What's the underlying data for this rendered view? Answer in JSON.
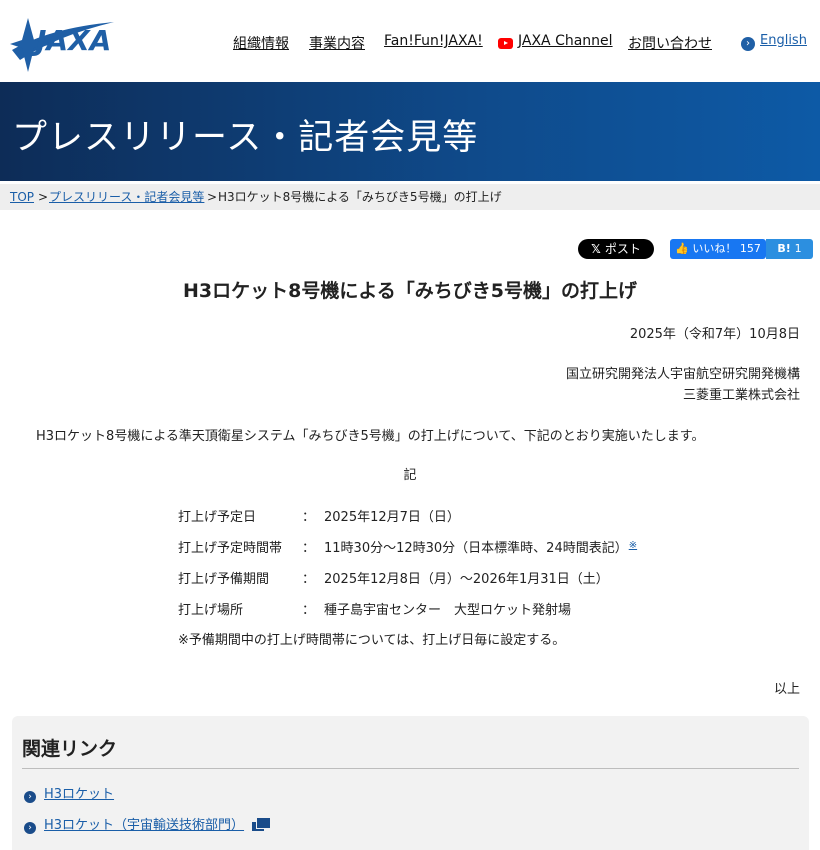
{
  "header": {
    "logo_text": "JAXA",
    "nav": [
      {
        "label": "組織情報"
      },
      {
        "label": "事業内容"
      },
      {
        "label": "Fan!Fun!JAXA!"
      },
      {
        "label": "JAXA Channel"
      },
      {
        "label": "お問い合わせ"
      }
    ],
    "english_label": "English"
  },
  "banner": {
    "title": "プレスリリース・記者会見等"
  },
  "breadcrumb": {
    "sep": ">",
    "items": [
      {
        "label": "TOP"
      },
      {
        "label": "プレスリリース・記者会見等"
      },
      {
        "label": "H3ロケット8号機による「みちびき5号機」の打上げ"
      }
    ]
  },
  "social": {
    "x_label": "ポスト",
    "fb_label": "いいね！",
    "fb_count": "157",
    "hatena_label": "B!",
    "hatena_count": "1"
  },
  "article": {
    "title": "H3ロケット8号機による「みちびき5号機」の打上げ",
    "date": "2025年（令和7年）10月8日",
    "org1": "国立研究開発法人宇宙航空研究開発機構",
    "org2": "三菱重工業株式会社",
    "intro": "H3ロケット8号機による準天頂衛星システム「みちびき5号機」の打上げについて、下記のとおり実施いたします。",
    "ki": "記",
    "colon": "：",
    "rows": [
      {
        "label": "打上げ予定日",
        "value": "2025年12月7日（日）"
      },
      {
        "label": "打上げ予定時間帯",
        "value": "11時30分～12時30分（日本標準時、24時間表記）",
        "note_mark": "※"
      },
      {
        "label": "打上げ予備期間",
        "value": "2025年12月8日（月）～2026年1月31日（土）"
      },
      {
        "label": "打上げ場所",
        "value": "種子島宇宙センター　大型ロケット発射場"
      }
    ],
    "note": "※予備期間中の打上げ時間帯については、打上げ日毎に設定する。",
    "end": "以上"
  },
  "related": {
    "title": "関連リンク",
    "links": [
      {
        "label": "H3ロケット"
      },
      {
        "label": "H3ロケット（宇宙輸送技術部門）"
      }
    ]
  },
  "colors": {
    "brand_blue": "#0f4b8c",
    "link_blue": "#1a5ea8",
    "youtube_red": "#ff0000"
  }
}
